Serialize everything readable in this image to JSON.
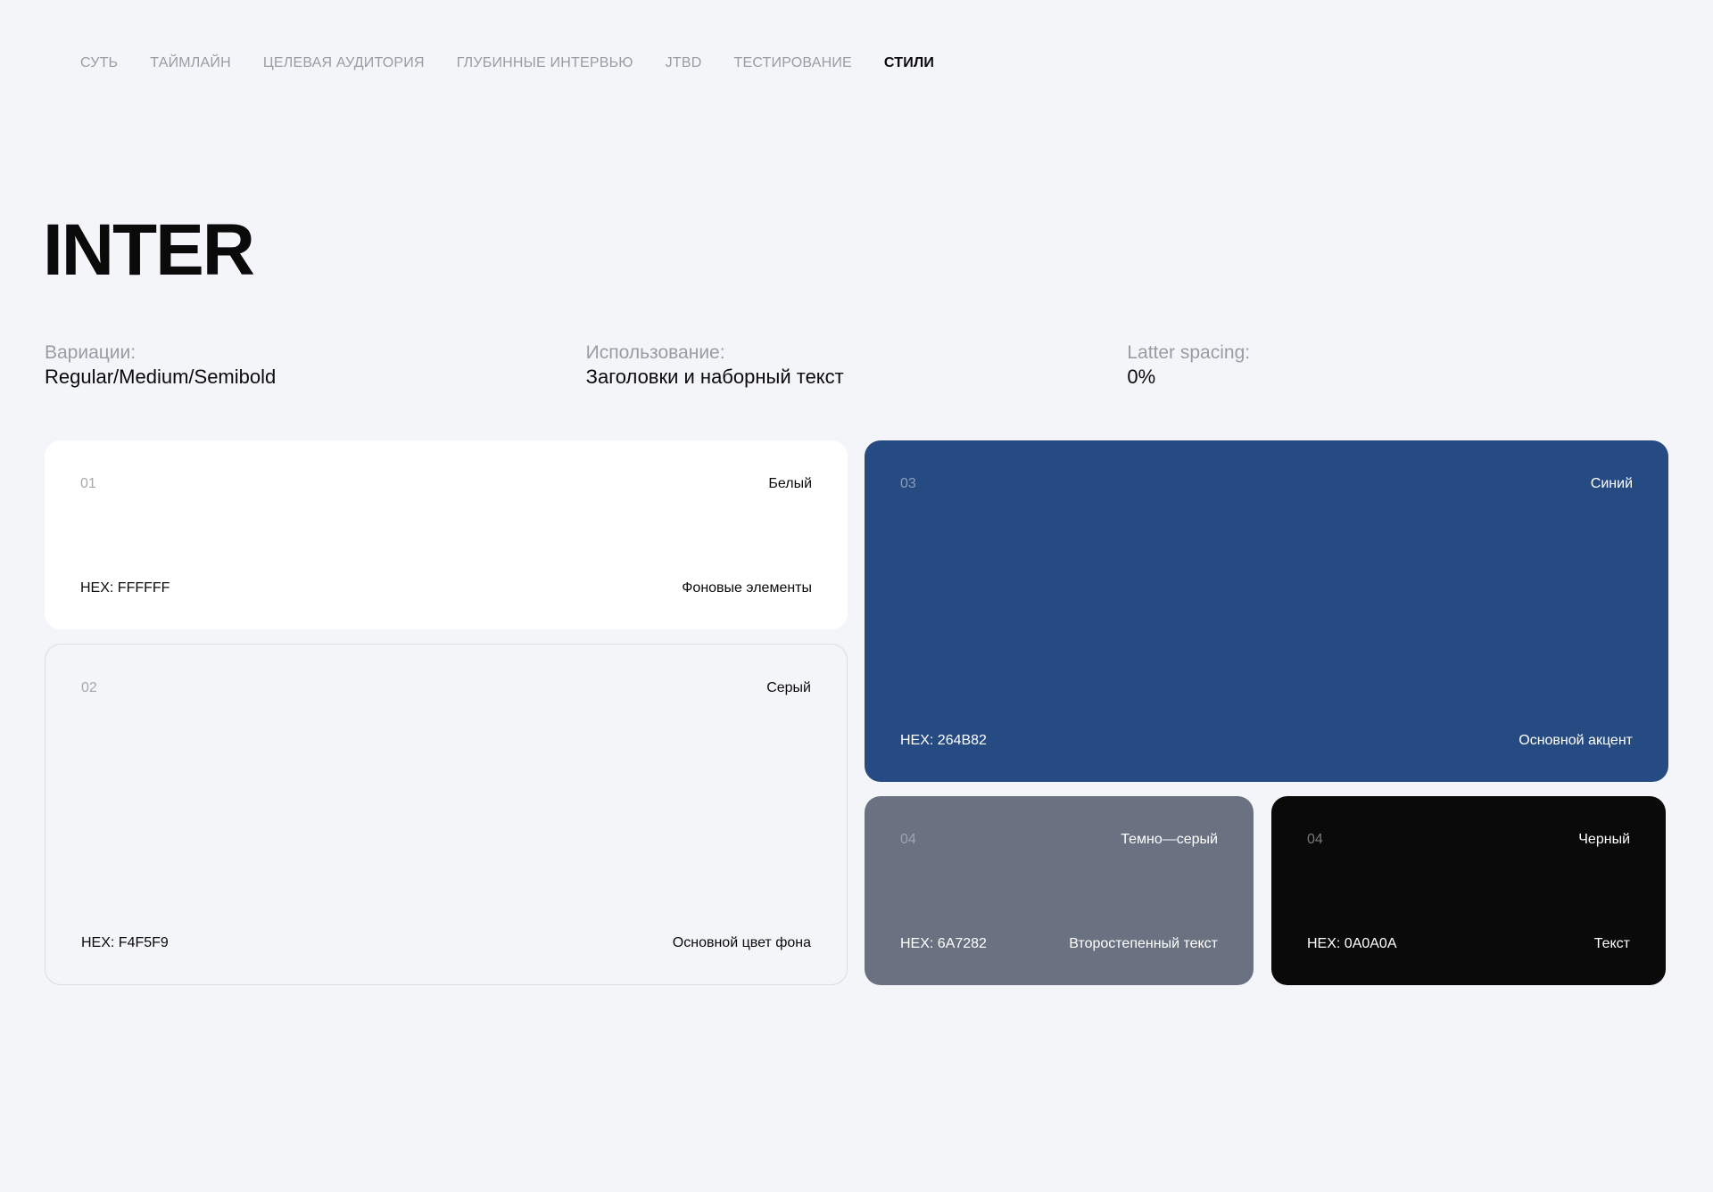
{
  "nav": {
    "items": [
      {
        "label": "СУТЬ",
        "active": false
      },
      {
        "label": "ТАЙМЛАЙН",
        "active": false
      },
      {
        "label": "ЦЕЛЕВАЯ АУДИТОРИЯ",
        "active": false
      },
      {
        "label": "ГЛУБИННЫЕ ИНТЕРВЬЮ",
        "active": false
      },
      {
        "label": "JTBD",
        "active": false
      },
      {
        "label": "ТЕСТИРОВАНИЕ",
        "active": false
      },
      {
        "label": "СТИЛИ",
        "active": true
      }
    ]
  },
  "font": {
    "name": "INTER",
    "variations_label": "Вариации:",
    "variations_value": "Regular/Medium/Semibold",
    "usage_label": "Использование:",
    "usage_value": "Заголовки и наборный текст",
    "spacing_label": "Latter spacing:",
    "spacing_value": "0%"
  },
  "colors": {
    "white": {
      "num": "01",
      "name": "Белый",
      "hex": "HEX: FFFFFF",
      "usage": "Фоновые элементы",
      "color": "#FFFFFF"
    },
    "gray": {
      "num": "02",
      "name": "Серый",
      "hex": "HEX: F4F5F9",
      "usage": "Основной цвет фона",
      "color": "#F4F5F9"
    },
    "blue": {
      "num": "03",
      "name": "Синий",
      "hex": "HEX: 264B82",
      "usage": "Основной акцент",
      "color": "#264B82"
    },
    "darkgray": {
      "num": "04",
      "name": "Темно—серый",
      "hex": "HEX: 6A7282",
      "usage": "Второстепенный текст",
      "color": "#6A7282"
    },
    "black": {
      "num": "04",
      "name": "Черный",
      "hex": "HEX: 0A0A0A",
      "usage": "Текст",
      "color": "#0A0A0A"
    }
  }
}
